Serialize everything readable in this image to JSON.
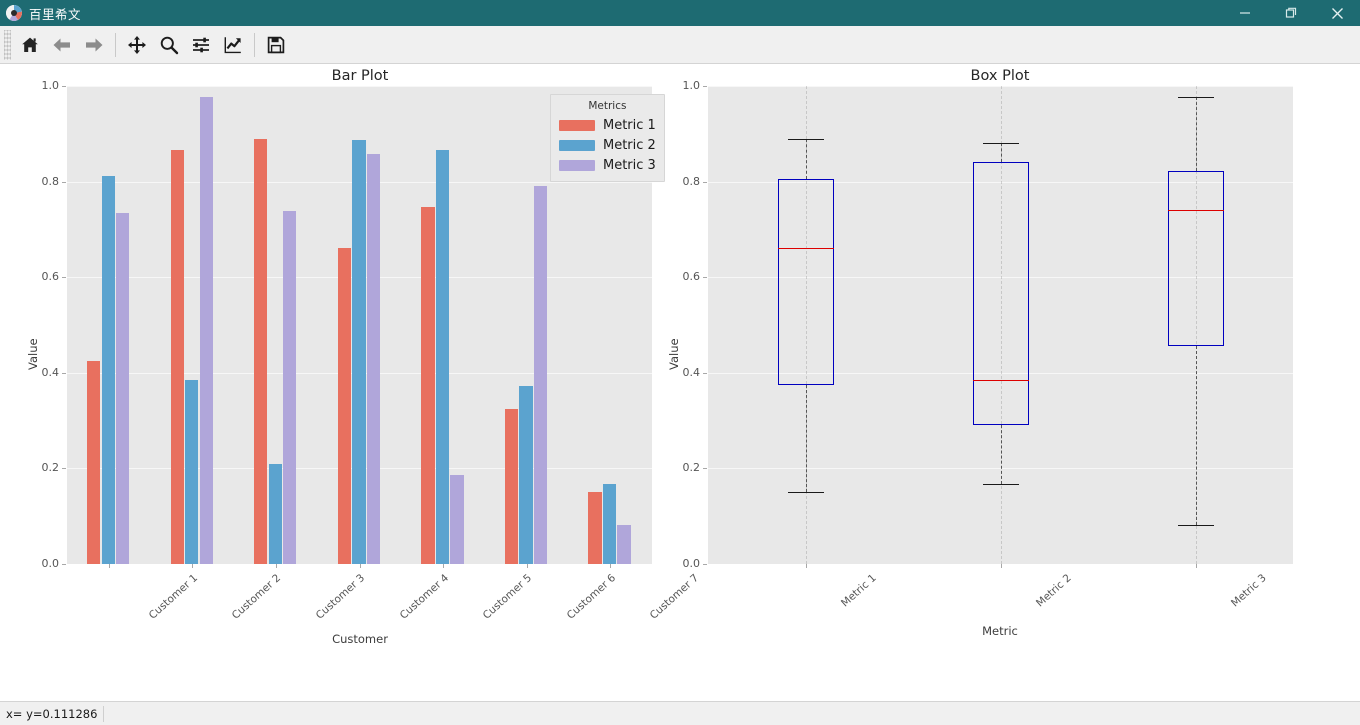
{
  "window": {
    "title": "百里希文",
    "icon": "matplotlib-logo-icon",
    "controls": {
      "minimize": "minimize-icon",
      "maximize": "maximize-icon",
      "close": "close-icon"
    }
  },
  "toolbar": {
    "buttons": [
      {
        "name": "home-icon",
        "tooltip": "Home"
      },
      {
        "name": "back-arrow-icon",
        "tooltip": "Back"
      },
      {
        "name": "forward-arrow-icon",
        "tooltip": "Forward"
      },
      {
        "name": "pan-move-icon",
        "tooltip": "Pan"
      },
      {
        "name": "zoom-magnifier-icon",
        "tooltip": "Zoom"
      },
      {
        "name": "configure-subplots-icon",
        "tooltip": "Subplots"
      },
      {
        "name": "edit-curve-icon",
        "tooltip": "Customize"
      },
      {
        "name": "save-floppy-icon",
        "tooltip": "Save"
      }
    ]
  },
  "statusbar": {
    "coordinates": "x= y=0.111286"
  },
  "colors": {
    "metric1": "#e8705f",
    "metric2": "#5ba3cf",
    "metric3": "#b0a6da",
    "plot_background": "#e8e8e8",
    "grid": "#f7f7f7",
    "box_edge": "#0000bf",
    "median": "#dd0000",
    "whisker": "#555555",
    "titlebar": "#1e6b72"
  },
  "chart_data": [
    {
      "type": "bar",
      "title": "Bar Plot",
      "xlabel": "Customer",
      "ylabel": "Value",
      "ylim": [
        0.0,
        1.0
      ],
      "yticks": [
        "0.0",
        "0.2",
        "0.4",
        "0.6",
        "0.8",
        "1.0"
      ],
      "ytick_values": [
        0.0,
        0.2,
        0.4,
        0.6,
        0.8,
        1.0
      ],
      "grid": true,
      "categories": [
        "Customer 1",
        "Customer 2",
        "Customer 3",
        "Customer 4",
        "Customer 5",
        "Customer 6",
        "Customer 7"
      ],
      "legend": {
        "title": "Metrics",
        "position": "upper right",
        "entries": [
          "Metric 1",
          "Metric 2",
          "Metric 3"
        ]
      },
      "series": [
        {
          "name": "Metric 1",
          "color": "#e8705f",
          "values": [
            0.425,
            0.866,
            0.89,
            0.661,
            0.746,
            0.324,
            0.151
          ]
        },
        {
          "name": "Metric 2",
          "color": "#5ba3cf",
          "values": [
            0.812,
            0.385,
            0.21,
            0.886,
            0.866,
            0.372,
            0.168
          ]
        },
        {
          "name": "Metric 3",
          "color": "#b0a6da",
          "values": [
            0.735,
            0.977,
            0.738,
            0.857,
            0.186,
            0.791,
            0.082
          ]
        }
      ]
    },
    {
      "type": "box",
      "title": "Box Plot",
      "xlabel": "Metric",
      "ylabel": "Value",
      "ylim": [
        0.0,
        1.0
      ],
      "yticks": [
        "0.0",
        "0.2",
        "0.4",
        "0.6",
        "0.8",
        "1.0"
      ],
      "ytick_values": [
        0.0,
        0.2,
        0.4,
        0.6,
        0.8,
        1.0
      ],
      "grid": true,
      "categories": [
        "Metric 1",
        "Metric 2",
        "Metric 3"
      ],
      "boxes": [
        {
          "name": "Metric 1",
          "whisker_low": 0.151,
          "q1": 0.375,
          "median": 0.661,
          "q3": 0.806,
          "whisker_high": 0.89
        },
        {
          "name": "Metric 2",
          "whisker_low": 0.168,
          "q1": 0.291,
          "median": 0.385,
          "q3": 0.84,
          "whisker_high": 0.88
        },
        {
          "name": "Metric 3",
          "whisker_low": 0.082,
          "q1": 0.456,
          "median": 0.74,
          "q3": 0.822,
          "whisker_high": 0.977
        }
      ]
    }
  ]
}
